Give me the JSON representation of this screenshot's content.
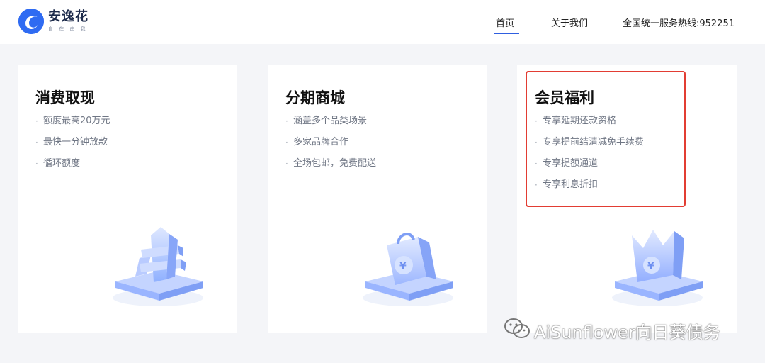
{
  "header": {
    "logo": {
      "name": "安逸花",
      "slogan": "自 在 由 我",
      "icon": "flower-logo-icon",
      "brand_color": "#2f6bf2"
    },
    "nav": {
      "home": "首页",
      "about": "关于我们",
      "hotline": "全国统一服务热线:952251",
      "active": "首页"
    }
  },
  "cards": [
    {
      "title": "消费取现",
      "items": [
        "额度最高20万元",
        "最快一分钟放款",
        "循环额度"
      ],
      "illustration": "yuan-coin-stack-icon"
    },
    {
      "title": "分期商城",
      "items": [
        "涵盖多个品类场景",
        "多家品牌合作",
        "全场包邮，免费配送"
      ],
      "illustration": "shopping-bag-icon"
    },
    {
      "title": "会员福利",
      "items": [
        "专享延期还款资格",
        "专享提前结清减免手续费",
        "专享提额通道",
        "专享利息折扣"
      ],
      "illustration": "crown-yuan-icon"
    }
  ],
  "list_bullet": "·",
  "annotation": {
    "color": "#e23d33"
  },
  "watermark": {
    "text": "AiSunflower向日葵债务",
    "icon": "wechat-icon"
  }
}
